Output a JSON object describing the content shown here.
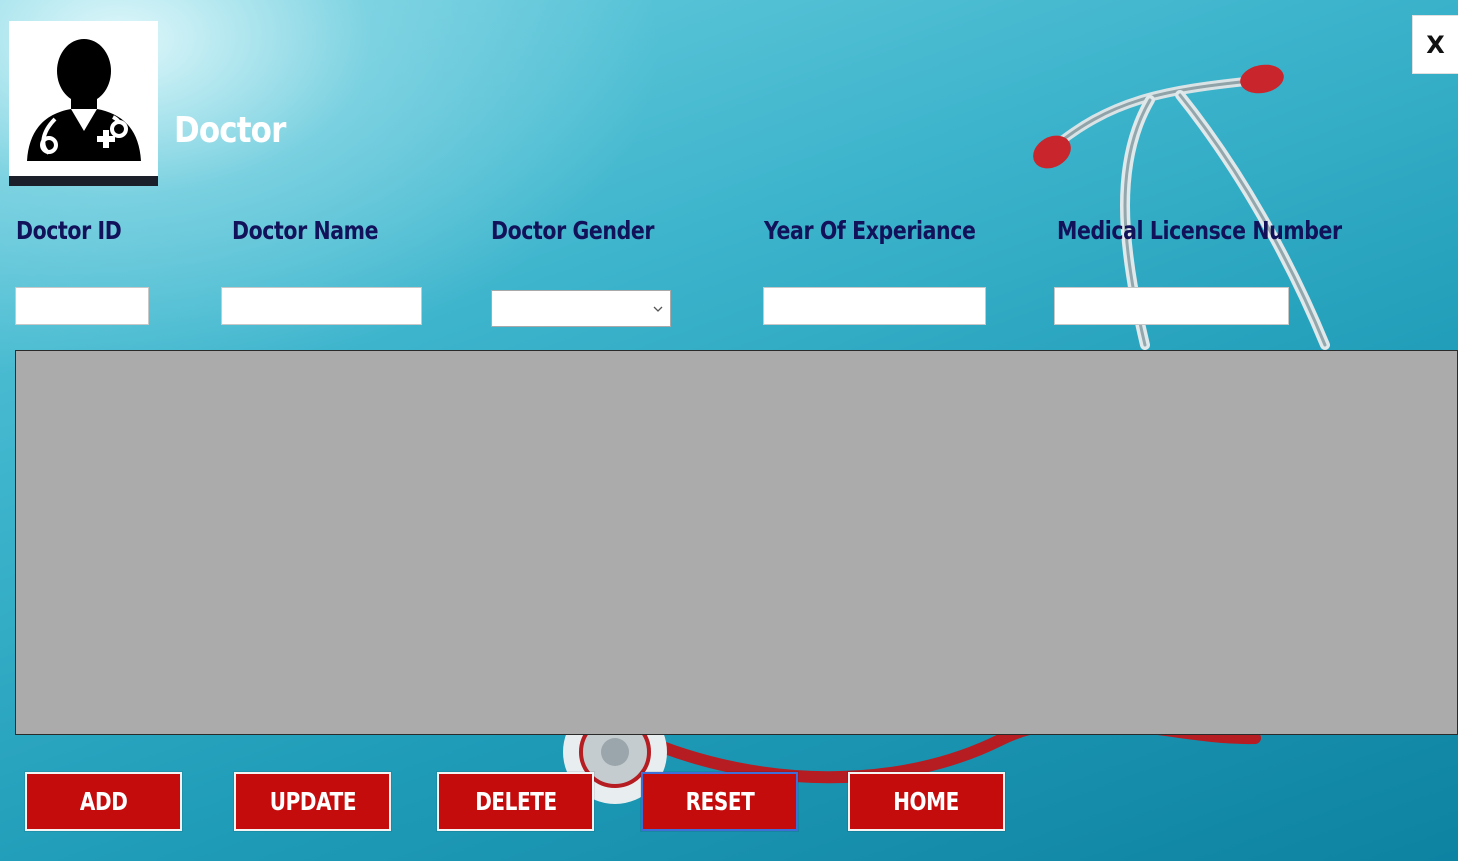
{
  "window": {
    "close_label": "X"
  },
  "header": {
    "title": "Doctor"
  },
  "form": {
    "fields": [
      {
        "label": "Doctor  ID",
        "value": ""
      },
      {
        "label": "Doctor  Name",
        "value": ""
      },
      {
        "label": "Doctor  Gender",
        "value": ""
      },
      {
        "label": "Year Of Experiance",
        "value": ""
      },
      {
        "label": "Medical Licensce Number",
        "value": ""
      }
    ]
  },
  "actions": {
    "add_label": "ADD",
    "update_label": "UPDATE",
    "delete_label": "DELETE",
    "reset_label": "RESET",
    "home_label": "HOME"
  },
  "icons": {
    "logo": "doctor-avatar-icon",
    "close": "close-icon",
    "dropdown": "chevron-down-icon"
  },
  "colors": {
    "label_text": "#12125a",
    "button_bg": "#c40c0c",
    "grid_bg": "#ababab",
    "title_text": "#ffffff"
  }
}
